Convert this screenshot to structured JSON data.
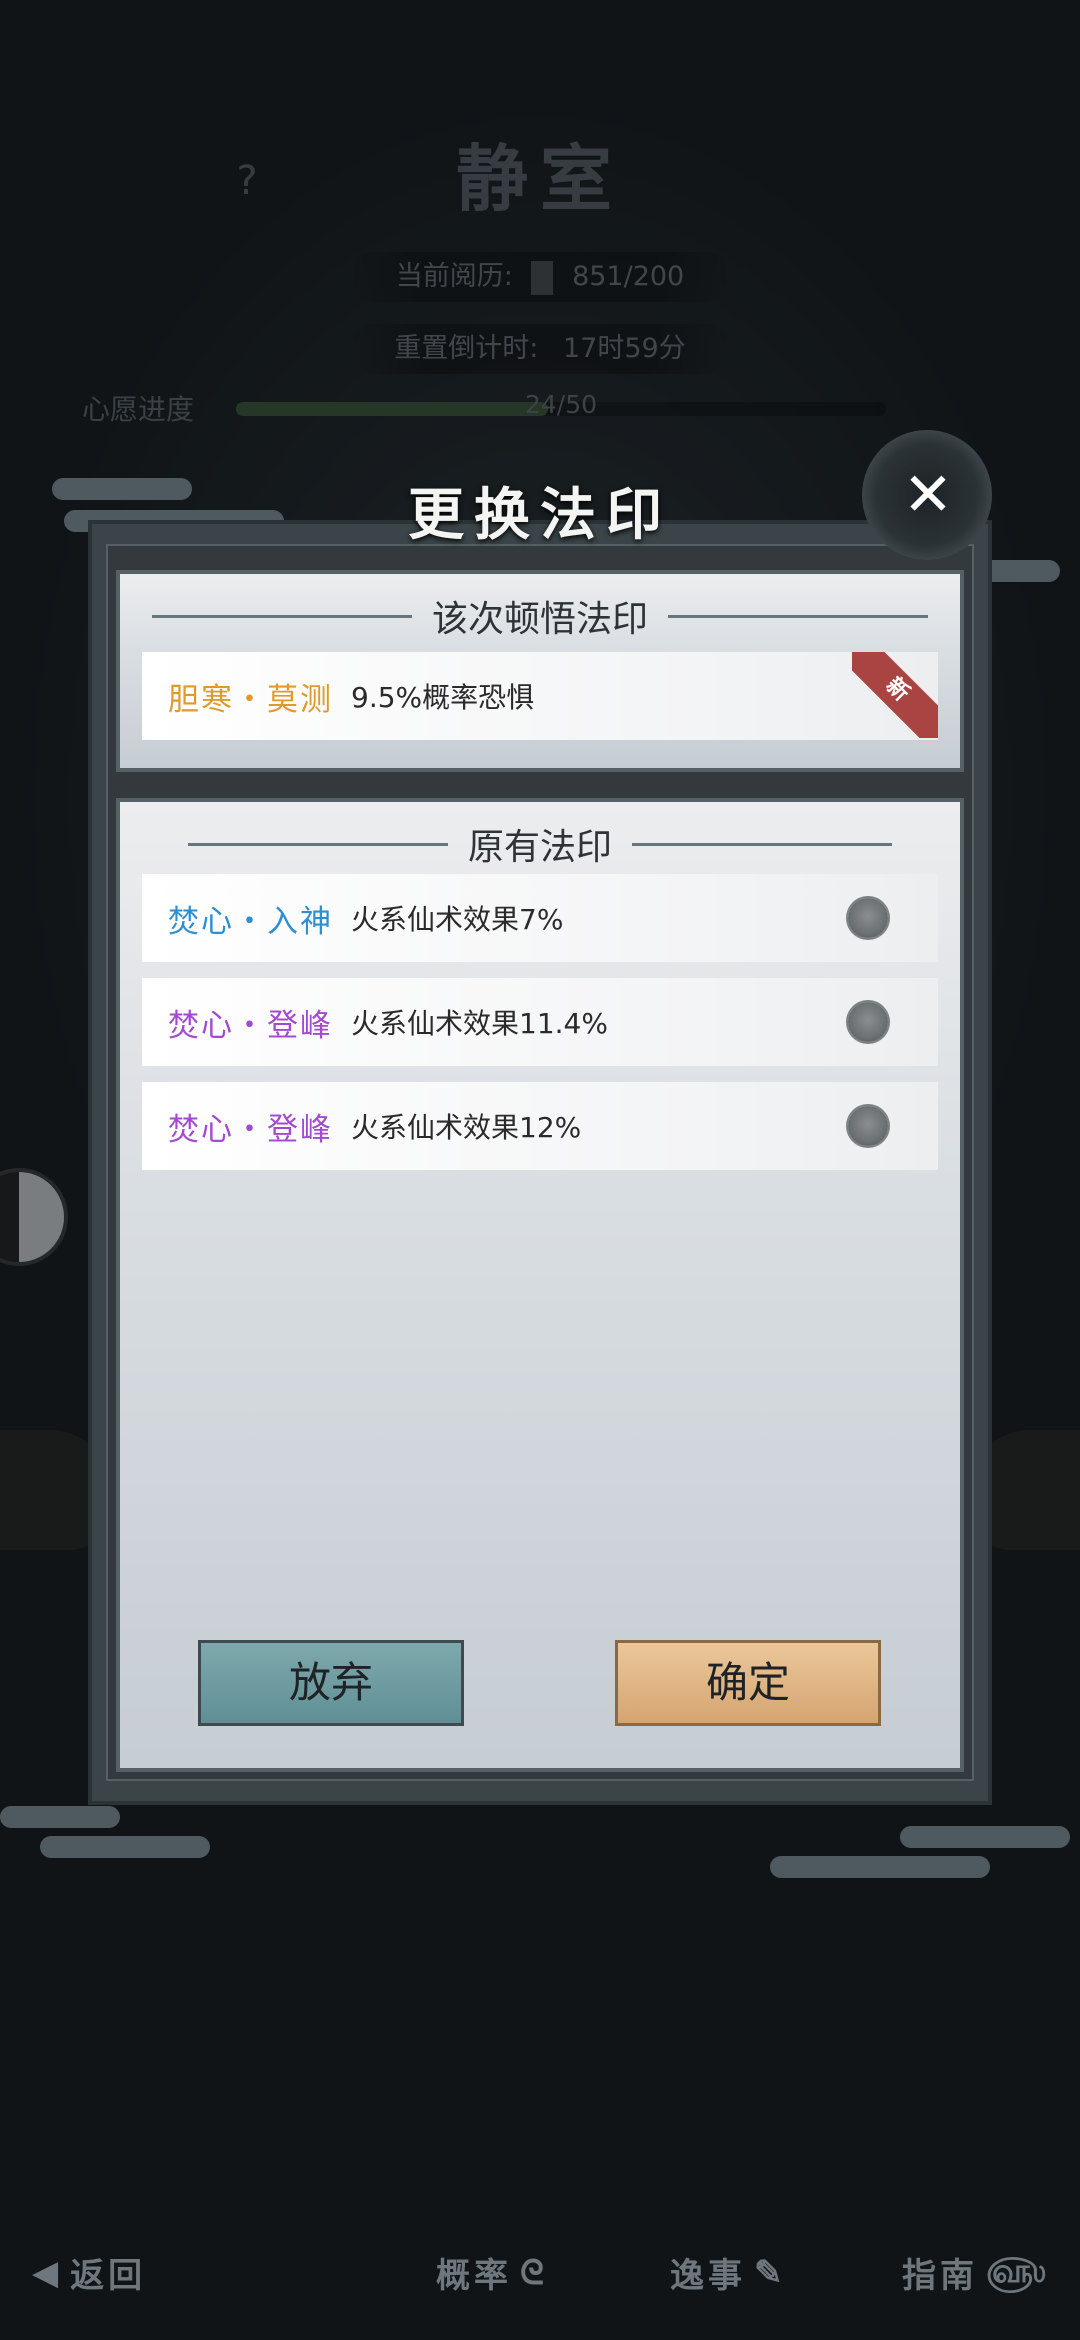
{
  "background": {
    "title": "静室",
    "help_label": "?",
    "experience_label": "当前阅历:",
    "experience_value": "851/200",
    "reset_label": "重置倒计时:",
    "reset_value": "17时59分",
    "wish_label": "心愿进度",
    "wish_value": "24/50",
    "wish_progress": 0.48
  },
  "dialog": {
    "title": "更换法印",
    "close_label": "✕",
    "current_section": {
      "header": "该次顿悟法印",
      "item": {
        "name": "胆寒・莫测",
        "name_color": "#e09a2a",
        "effect": "9.5%概率恐惧",
        "badge": "新"
      }
    },
    "existing_section": {
      "header": "原有法印",
      "items": [
        {
          "name": "焚心・入神",
          "name_color": "#2e8fd0",
          "effect": "火系仙术效果7%"
        },
        {
          "name": "焚心・登峰",
          "name_color": "#a34bd0",
          "effect": "火系仙术效果11.4%"
        },
        {
          "name": "焚心・登峰",
          "name_color": "#a34bd0",
          "effect": "火系仙术效果12%"
        }
      ]
    },
    "abandon_label": "放弃",
    "confirm_label": "确定"
  },
  "bottom_nav": {
    "back": "返回",
    "probability": "概率",
    "anecdote": "逸事",
    "guide": "指南"
  },
  "colors": {
    "abandon_button": "#6f9ea3",
    "confirm_button": "#e2b684",
    "new_badge": "#a94443"
  }
}
